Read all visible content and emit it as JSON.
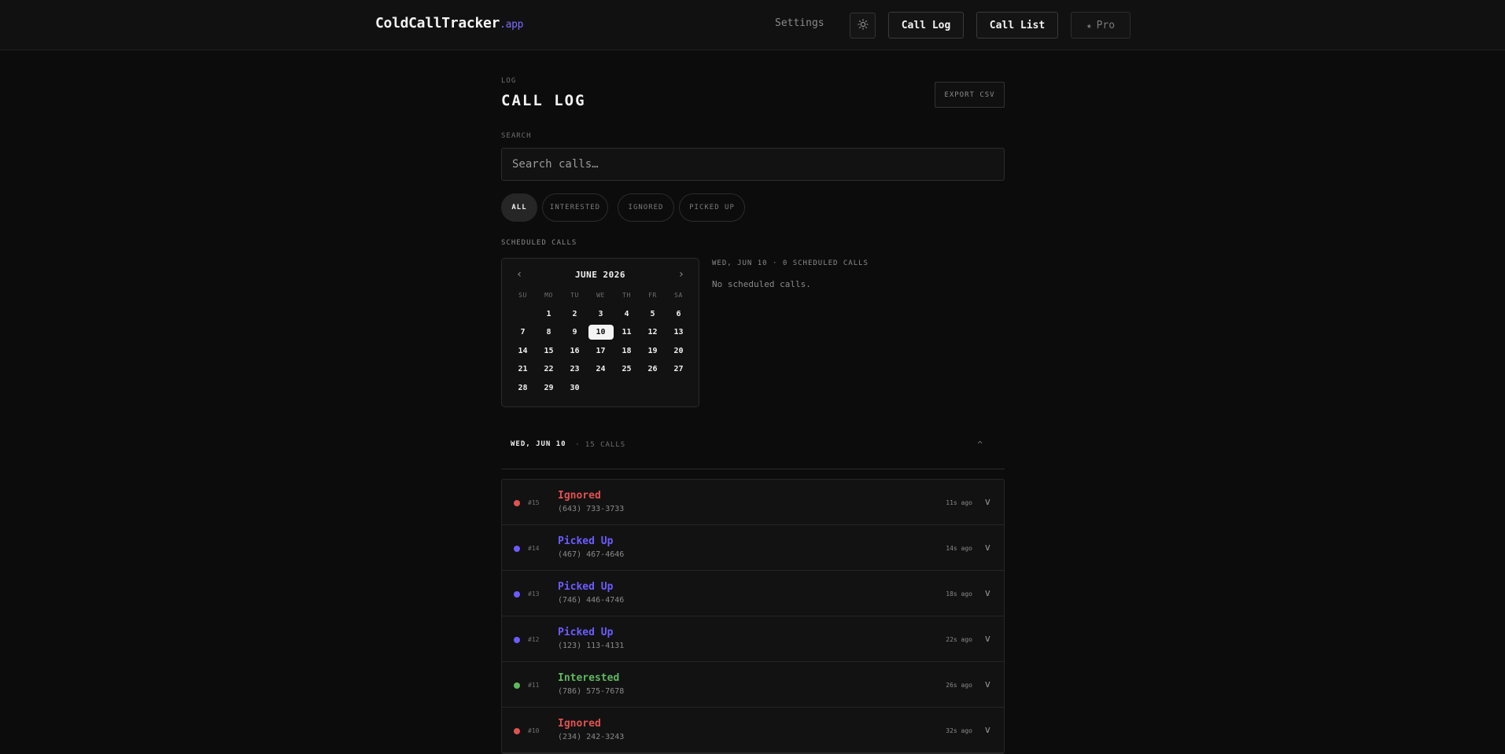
{
  "header": {
    "brand": "ColdCallTracker",
    "brand_tld": ".app",
    "settings_label": "Settings",
    "theme_icon": "sun-icon",
    "call_log_label": "Call Log",
    "call_list_label": "Call List",
    "pro_label": "Pro",
    "pro_icon": "star-icon"
  },
  "main": {
    "eyebrow": "LOG",
    "title": "CALL LOG",
    "export_label": "EXPORT CSV",
    "search_label": "SEARCH",
    "search_placeholder": "Search calls…",
    "filters": [
      "ALL",
      "INTERESTED",
      "IGNORED",
      "PICKED UP"
    ],
    "active_filter": "ALL",
    "scheduled_label": "SCHEDULED CALLS"
  },
  "calendar": {
    "month": "JUNE 2026",
    "prev_icon": "chevron-left-icon",
    "next_icon": "chevron-right-icon",
    "weekdays": [
      "SU",
      "MO",
      "TU",
      "WE",
      "TH",
      "FR",
      "SA"
    ],
    "weeks": [
      [
        "",
        "1",
        "2",
        "3",
        "4",
        "5",
        "6"
      ],
      [
        "7",
        "8",
        "9",
        "10",
        "11",
        "12",
        "13"
      ],
      [
        "14",
        "15",
        "16",
        "17",
        "18",
        "19",
        "20"
      ],
      [
        "21",
        "22",
        "23",
        "24",
        "25",
        "26",
        "27"
      ],
      [
        "28",
        "29",
        "30",
        "",
        "",
        "",
        ""
      ]
    ],
    "selected": "10"
  },
  "schedule": {
    "day_heading": "WED, JUN 10 · 0 SCHEDULED CALLS",
    "empty_text": "No scheduled calls."
  },
  "group": {
    "date": "WED, JUN 10",
    "count": "· 15 CALLS",
    "toggle_icon": "chevron-up-icon"
  },
  "colors": {
    "ignored": "#e05252",
    "picked_up": "#6c5cff",
    "interested": "#5fb85f",
    "accent": "#7c6cff"
  },
  "calls": [
    {
      "num": "#15",
      "status": "Ignored",
      "kind": "ignored",
      "phone": "(643) 733-3733",
      "ago": "11s ago"
    },
    {
      "num": "#14",
      "status": "Picked Up",
      "kind": "picked_up",
      "phone": "(467) 467-4646",
      "ago": "14s ago"
    },
    {
      "num": "#13",
      "status": "Picked Up",
      "kind": "picked_up",
      "phone": "(746) 446-4746",
      "ago": "18s ago"
    },
    {
      "num": "#12",
      "status": "Picked Up",
      "kind": "picked_up",
      "phone": "(123) 113-4131",
      "ago": "22s ago"
    },
    {
      "num": "#11",
      "status": "Interested",
      "kind": "interested",
      "phone": "(786) 575-7678",
      "ago": "26s ago"
    },
    {
      "num": "#10",
      "status": "Ignored",
      "kind": "ignored",
      "phone": "(234) 242-3243",
      "ago": "32s ago"
    }
  ]
}
